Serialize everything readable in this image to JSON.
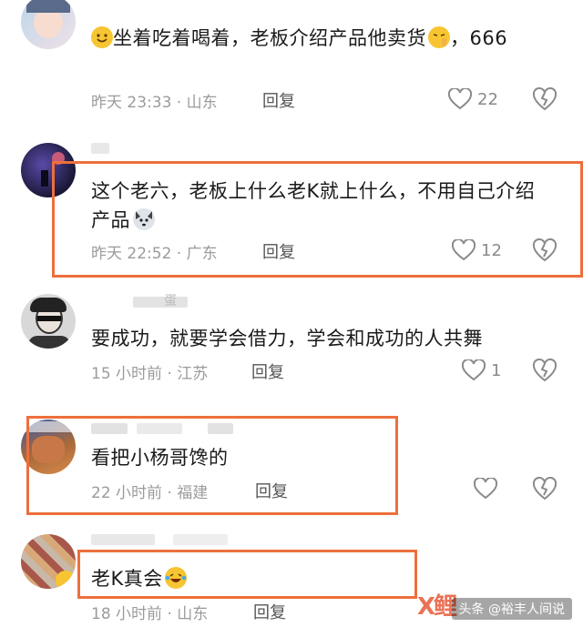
{
  "comments": [
    {
      "text": "坐着吃着喝着，老板介绍产品他卖货",
      "text_cont": "，666",
      "time_location": "昨天 23:33 · 山东",
      "reply_label": "回复",
      "like_count": "22"
    },
    {
      "text": "这个老六，老板上什么老K就上什么，不用自己介绍产品",
      "time_location": "昨天 22:52 · 广东",
      "reply_label": "回复",
      "like_count": "12"
    },
    {
      "username": "蛋",
      "text": "要成功，就要学会借力，学会和成功的人共舞",
      "time_location": "15 小时前 · 江苏",
      "reply_label": "回复",
      "like_count": "1"
    },
    {
      "text": "看把小杨哥馋的",
      "time_location": "22 小时前 · 福建",
      "reply_label": "回复",
      "like_count": ""
    },
    {
      "text": "老K真会",
      "time_location": "18 小时前 · 山东",
      "reply_label": "回复",
      "like_count": ""
    }
  ],
  "watermark": {
    "text": "头条 @裕丰人间说",
    "logo": "X鲤"
  },
  "colors": {
    "highlight": "#ee6f3c",
    "meta": "#9b9b9b",
    "text": "#1a1a1a"
  }
}
